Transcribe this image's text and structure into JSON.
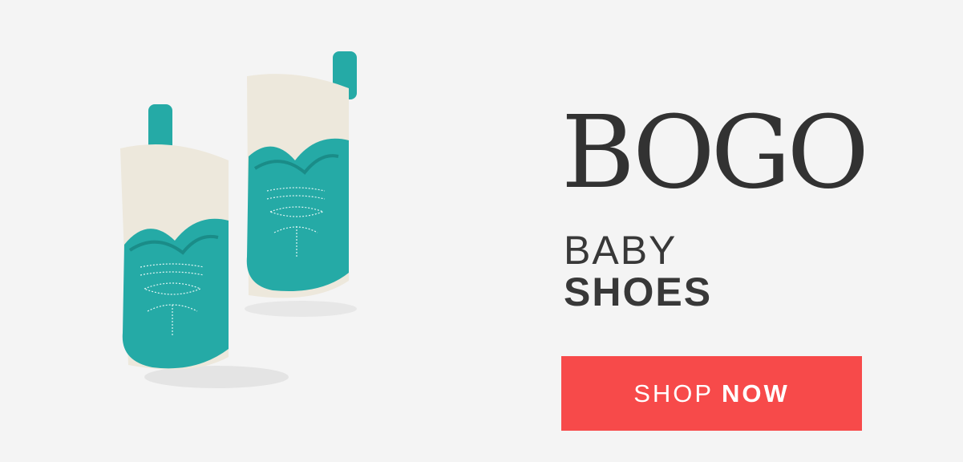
{
  "banner": {
    "headline": "BOGO",
    "sub_line_1": "BABY",
    "sub_line_2": "SHOES",
    "cta": {
      "light": "SHOP",
      "bold": "NOW"
    }
  },
  "colors": {
    "background": "#f4f4f4",
    "text": "#323232",
    "cta_background": "#f74a4a",
    "cta_text": "#ffffff",
    "shoe_teal": "#25aaa6",
    "shoe_cream": "#ede8dc"
  },
  "product_image": {
    "subject": "teal-baby-cowboy-boot-shoes"
  }
}
